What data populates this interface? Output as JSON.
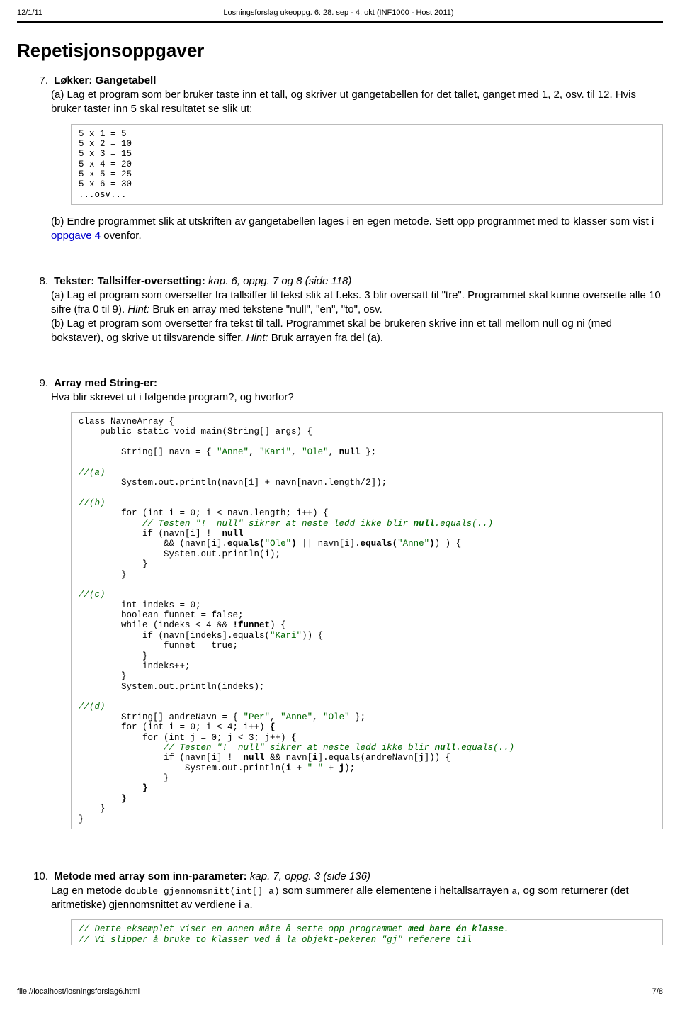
{
  "header": {
    "left": "12/1/11",
    "center": "Losningsforslag ukeoppg. 6: 28. sep - 4. okt (INF1000 - Host 2011)"
  },
  "title": "Repetisjonsoppgaver",
  "t7": {
    "num": "7.",
    "title_bold": "Løkker: Gangetabell",
    "a": "(a) Lag et program som ber bruker taste inn et tall, og skriver ut gangetabellen for det tallet, ganget med 1, 2, osv. til 12.  Hvis bruker taster inn 5 skal resultatet se slik ut:",
    "code": "5 x 1 = 5\n5 x 2 = 10\n5 x 3 = 15\n5 x 4 = 20\n5 x 5 = 25\n5 x 6 = 30\n...osv...",
    "b_pre": "(b) Endre programmet slik at utskriften av gangetabellen lages i en egen metode.  Sett opp programmet med to klasser som vist i ",
    "b_link": "oppgave 4",
    "b_post": " ovenfor."
  },
  "t8": {
    "num": "8.",
    "title_bold": "Tekster: Tallsiffer-oversetting:",
    "title_it": "  kap. 6, oppg. 7 og 8 (side 118)",
    "body": "(a) Lag et program som oversetter fra tallsiffer til tekst slik at f.eks. 3 blir oversatt til \"tre\".  Programmet skal kunne oversette alle 10 sifre (fra 0 til 9).  ",
    "hint1_i": "Hint:",
    "hint1": " Bruk en array med tekstene \"null\", \"en\", \"to\", osv.",
    "body2": "(b) Lag et program som oversetter fra tekst til tall.  Programmet skal be brukeren skrive inn et tall mellom null og ni (med bokstaver), og skrive ut tilsvarende siffer. ",
    "hint2_i": "Hint:",
    "hint2": " Bruk arrayen fra del (a)."
  },
  "t9": {
    "num": "9.",
    "title_bold": "Array med String-er:",
    "body": "Hva blir skrevet ut i følgende program?, og hvorfor?"
  },
  "t10": {
    "num": "10.",
    "title_bold": "Metode med array som inn-parameter:",
    "title_it": " kap. 7, oppg. 3 (side 136)",
    "body_pre": "Lag en metode ",
    "mono1": "double gjennomsnitt(int[] a)",
    "body_mid": " som summerer alle elementene i heltallsarrayen ",
    "mono2": "a",
    "body_post": ", og som returnerer (det aritmetiske) gjennomsnittet av verdiene i ",
    "mono3": "a",
    "body_end": "."
  },
  "footer": {
    "left": "file://localhost/losningsforslag6.html",
    "right": "7/8"
  }
}
